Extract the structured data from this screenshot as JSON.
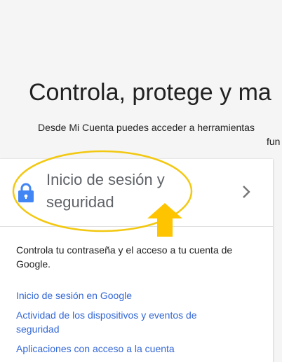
{
  "hero": {
    "title": "Controla, protege y ma",
    "subtitle": "Desde Mi Cuenta puedes acceder a herramientas",
    "subtitle_wrap": "fun"
  },
  "card": {
    "title": "Inicio de sesión y seguridad",
    "icon": "lock-icon",
    "chevron": "chevron-right-icon",
    "description": "Controla tu contraseña y el acceso a tu cuenta de Google.",
    "links": [
      "Inicio de sesión en Google",
      "Actividad de los dispositivos y eventos de seguridad",
      "Aplicaciones con acceso a la cuenta"
    ]
  },
  "annotation": {
    "highlight_color": "#f2c811",
    "arrow_color": "#ffc400"
  },
  "colors": {
    "link": "#3367d6",
    "lock": "#4285f4",
    "background": "#f5f5f5"
  }
}
